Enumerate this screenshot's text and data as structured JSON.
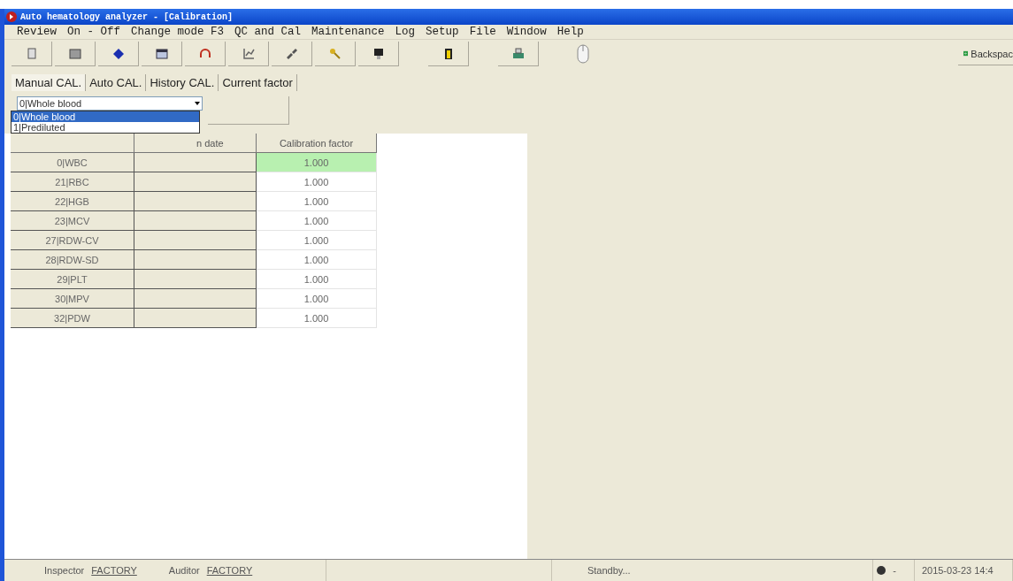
{
  "window": {
    "title": "Auto hematology analyzer - [Calibration]"
  },
  "menu": [
    "Review",
    "On - Off",
    "Change mode F3",
    "QC and Cal",
    "Maintenance",
    "Log",
    "Setup",
    "File",
    "Window",
    "Help"
  ],
  "toolbar": {
    "backspace": "Backspac"
  },
  "tabs": [
    {
      "label": "Manual CAL.",
      "selected": true
    },
    {
      "label": "Auto CAL.",
      "selected": false
    },
    {
      "label": "History CAL.",
      "selected": false
    },
    {
      "label": "Current factor",
      "selected": false
    }
  ],
  "mode_select": {
    "value": "0|Whole blood",
    "expanded": true,
    "options": [
      {
        "label": "0|Whole blood",
        "selected": true
      },
      {
        "label": "1|Prediluted",
        "selected": false
      }
    ]
  },
  "table": {
    "columns": [
      {
        "label": "n date"
      },
      {
        "label": "Calibration factor"
      }
    ],
    "rows": [
      {
        "parameter": "0|WBC",
        "factor": "1.000",
        "selected": true
      },
      {
        "parameter": "21|RBC",
        "factor": "1.000",
        "selected": false
      },
      {
        "parameter": "22|HGB",
        "factor": "1.000",
        "selected": false
      },
      {
        "parameter": "23|MCV",
        "factor": "1.000",
        "selected": false
      },
      {
        "parameter": "27|RDW-CV",
        "factor": "1.000",
        "selected": false
      },
      {
        "parameter": "28|RDW-SD",
        "factor": "1.000",
        "selected": false
      },
      {
        "parameter": "29|PLT",
        "factor": "1.000",
        "selected": false
      },
      {
        "parameter": "30|MPV",
        "factor": "1.000",
        "selected": false
      },
      {
        "parameter": "32|PDW",
        "factor": "1.000",
        "selected": false
      }
    ]
  },
  "status_bar": {
    "inspector_label": "Inspector",
    "inspector": "FACTORY",
    "auditor_label": "Auditor",
    "auditor": "FACTORY",
    "status": "Standby...",
    "indicator": "-",
    "datetime": "2015-03-23 14:4"
  }
}
